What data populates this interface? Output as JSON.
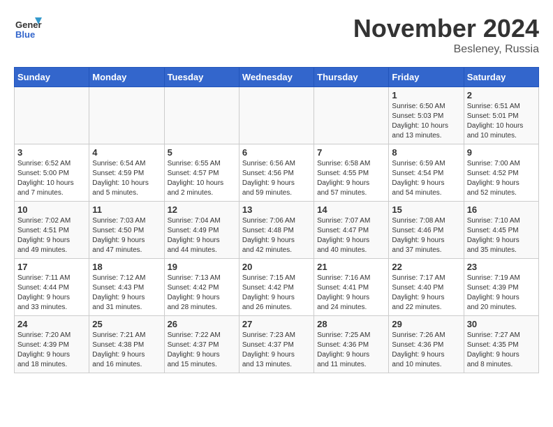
{
  "header": {
    "logo_line1": "General",
    "logo_line2": "Blue",
    "month": "November 2024",
    "location": "Besleney, Russia"
  },
  "weekdays": [
    "Sunday",
    "Monday",
    "Tuesday",
    "Wednesday",
    "Thursday",
    "Friday",
    "Saturday"
  ],
  "weeks": [
    [
      {
        "day": "",
        "info": ""
      },
      {
        "day": "",
        "info": ""
      },
      {
        "day": "",
        "info": ""
      },
      {
        "day": "",
        "info": ""
      },
      {
        "day": "",
        "info": ""
      },
      {
        "day": "1",
        "info": "Sunrise: 6:50 AM\nSunset: 5:03 PM\nDaylight: 10 hours\nand 13 minutes."
      },
      {
        "day": "2",
        "info": "Sunrise: 6:51 AM\nSunset: 5:01 PM\nDaylight: 10 hours\nand 10 minutes."
      }
    ],
    [
      {
        "day": "3",
        "info": "Sunrise: 6:52 AM\nSunset: 5:00 PM\nDaylight: 10 hours\nand 7 minutes."
      },
      {
        "day": "4",
        "info": "Sunrise: 6:54 AM\nSunset: 4:59 PM\nDaylight: 10 hours\nand 5 minutes."
      },
      {
        "day": "5",
        "info": "Sunrise: 6:55 AM\nSunset: 4:57 PM\nDaylight: 10 hours\nand 2 minutes."
      },
      {
        "day": "6",
        "info": "Sunrise: 6:56 AM\nSunset: 4:56 PM\nDaylight: 9 hours\nand 59 minutes."
      },
      {
        "day": "7",
        "info": "Sunrise: 6:58 AM\nSunset: 4:55 PM\nDaylight: 9 hours\nand 57 minutes."
      },
      {
        "day": "8",
        "info": "Sunrise: 6:59 AM\nSunset: 4:54 PM\nDaylight: 9 hours\nand 54 minutes."
      },
      {
        "day": "9",
        "info": "Sunrise: 7:00 AM\nSunset: 4:52 PM\nDaylight: 9 hours\nand 52 minutes."
      }
    ],
    [
      {
        "day": "10",
        "info": "Sunrise: 7:02 AM\nSunset: 4:51 PM\nDaylight: 9 hours\nand 49 minutes."
      },
      {
        "day": "11",
        "info": "Sunrise: 7:03 AM\nSunset: 4:50 PM\nDaylight: 9 hours\nand 47 minutes."
      },
      {
        "day": "12",
        "info": "Sunrise: 7:04 AM\nSunset: 4:49 PM\nDaylight: 9 hours\nand 44 minutes."
      },
      {
        "day": "13",
        "info": "Sunrise: 7:06 AM\nSunset: 4:48 PM\nDaylight: 9 hours\nand 42 minutes."
      },
      {
        "day": "14",
        "info": "Sunrise: 7:07 AM\nSunset: 4:47 PM\nDaylight: 9 hours\nand 40 minutes."
      },
      {
        "day": "15",
        "info": "Sunrise: 7:08 AM\nSunset: 4:46 PM\nDaylight: 9 hours\nand 37 minutes."
      },
      {
        "day": "16",
        "info": "Sunrise: 7:10 AM\nSunset: 4:45 PM\nDaylight: 9 hours\nand 35 minutes."
      }
    ],
    [
      {
        "day": "17",
        "info": "Sunrise: 7:11 AM\nSunset: 4:44 PM\nDaylight: 9 hours\nand 33 minutes."
      },
      {
        "day": "18",
        "info": "Sunrise: 7:12 AM\nSunset: 4:43 PM\nDaylight: 9 hours\nand 31 minutes."
      },
      {
        "day": "19",
        "info": "Sunrise: 7:13 AM\nSunset: 4:42 PM\nDaylight: 9 hours\nand 28 minutes."
      },
      {
        "day": "20",
        "info": "Sunrise: 7:15 AM\nSunset: 4:42 PM\nDaylight: 9 hours\nand 26 minutes."
      },
      {
        "day": "21",
        "info": "Sunrise: 7:16 AM\nSunset: 4:41 PM\nDaylight: 9 hours\nand 24 minutes."
      },
      {
        "day": "22",
        "info": "Sunrise: 7:17 AM\nSunset: 4:40 PM\nDaylight: 9 hours\nand 22 minutes."
      },
      {
        "day": "23",
        "info": "Sunrise: 7:19 AM\nSunset: 4:39 PM\nDaylight: 9 hours\nand 20 minutes."
      }
    ],
    [
      {
        "day": "24",
        "info": "Sunrise: 7:20 AM\nSunset: 4:39 PM\nDaylight: 9 hours\nand 18 minutes."
      },
      {
        "day": "25",
        "info": "Sunrise: 7:21 AM\nSunset: 4:38 PM\nDaylight: 9 hours\nand 16 minutes."
      },
      {
        "day": "26",
        "info": "Sunrise: 7:22 AM\nSunset: 4:37 PM\nDaylight: 9 hours\nand 15 minutes."
      },
      {
        "day": "27",
        "info": "Sunrise: 7:23 AM\nSunset: 4:37 PM\nDaylight: 9 hours\nand 13 minutes."
      },
      {
        "day": "28",
        "info": "Sunrise: 7:25 AM\nSunset: 4:36 PM\nDaylight: 9 hours\nand 11 minutes."
      },
      {
        "day": "29",
        "info": "Sunrise: 7:26 AM\nSunset: 4:36 PM\nDaylight: 9 hours\nand 10 minutes."
      },
      {
        "day": "30",
        "info": "Sunrise: 7:27 AM\nSunset: 4:35 PM\nDaylight: 9 hours\nand 8 minutes."
      }
    ]
  ]
}
